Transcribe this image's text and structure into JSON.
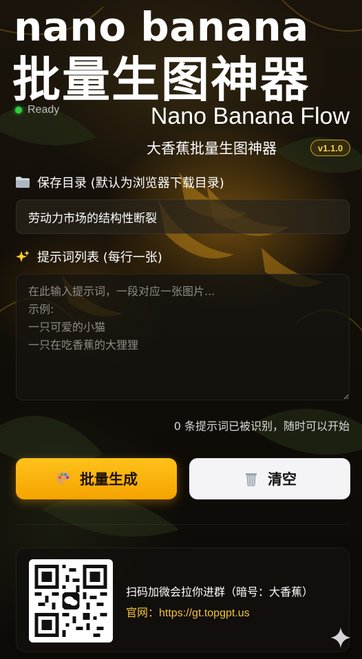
{
  "header": {
    "title_en": "nano banana",
    "title_cn": "批量生图神器",
    "status": "Ready",
    "subtitle": "Nano Banana Flow",
    "subtitle_cn": "大香蕉批量生图神器",
    "version": "v1.1.0"
  },
  "save_dir": {
    "label": "保存目录 (默认为浏览器下载目录)",
    "icon": "folder-icon",
    "value": "劳动力市场的结构性断裂"
  },
  "prompts": {
    "label": "提示词列表 (每行一张)",
    "icon": "sparkles-icon",
    "placeholder": "在此输入提示词，一段对应一张图片...\n示例:\n一只可爱的小猫\n一只在吃香蕉的大狸狸",
    "count_text": "0 条提示词已被识别，随时可以开始"
  },
  "actions": {
    "generate_label": "批量生成",
    "generate_icon": "palette-icon",
    "clear_label": "清空",
    "clear_icon": "trash-icon"
  },
  "footer": {
    "join_text": "扫码加微会拉你进群（暗号：大香蕉）",
    "site_label": "官网：",
    "site_url": "https://gt.topgpt.us"
  },
  "colors": {
    "accent": "#f5a300",
    "status_ready": "#2ecc40",
    "link": "#f3c23a"
  }
}
